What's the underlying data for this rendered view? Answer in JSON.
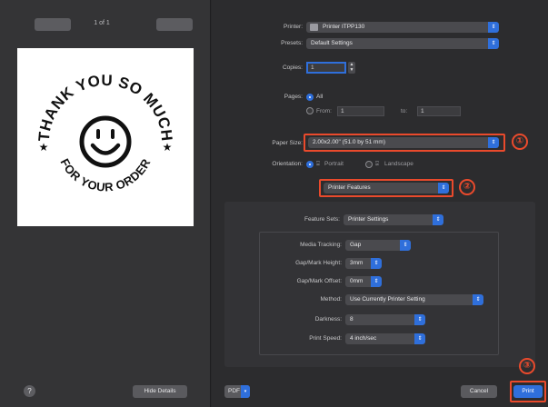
{
  "preview": {
    "page_indicator": "1 of 1",
    "sticker": {
      "arc_top": "THANK YOU SO MUCH",
      "arc_bottom": "FOR YOUR ORDER",
      "star": "★"
    }
  },
  "left_footer": {
    "help": "?",
    "hide_details": "Hide Details"
  },
  "options": {
    "printer": {
      "label": "Printer:",
      "value": "Printer ITPP130"
    },
    "presets": {
      "label": "Presets:",
      "value": "Default Settings"
    },
    "copies": {
      "label": "Copies:",
      "value": "1"
    },
    "pages": {
      "label": "Pages:",
      "all": "All",
      "from": "From:",
      "from_value": "1",
      "to": "to:",
      "to_value": "1"
    },
    "paper_size": {
      "label": "Paper Size:",
      "value": "2.00x2.00\" (51.0 by 51 mm)"
    },
    "orientation": {
      "label": "Orientation:",
      "portrait": "Portrait",
      "landscape": "Landscape"
    },
    "section_popup": "Printer Features"
  },
  "features": {
    "feature_sets": {
      "label": "Feature Sets:",
      "value": "Printer Settings"
    },
    "rows": [
      {
        "label": "Media Tracking:",
        "value": "Gap"
      },
      {
        "label": "Gap/Mark Height:",
        "value": "3mm"
      },
      {
        "label": "Gap/Mark Offset:",
        "value": "0mm"
      },
      {
        "label": "Method:",
        "value": "Use Currently Printer Setting"
      },
      {
        "label": "Darkness:",
        "value": "8"
      },
      {
        "label": "Print Speed:",
        "value": "4 inch/sec"
      }
    ]
  },
  "footer": {
    "pdf": "PDF",
    "cancel": "Cancel",
    "print": "Print"
  },
  "annotations": [
    "①",
    "②",
    "③"
  ],
  "colors": {
    "accent": "#2f6fdb",
    "highlight": "#ea4a2c",
    "sheet_bg": "#2c2c2e"
  }
}
